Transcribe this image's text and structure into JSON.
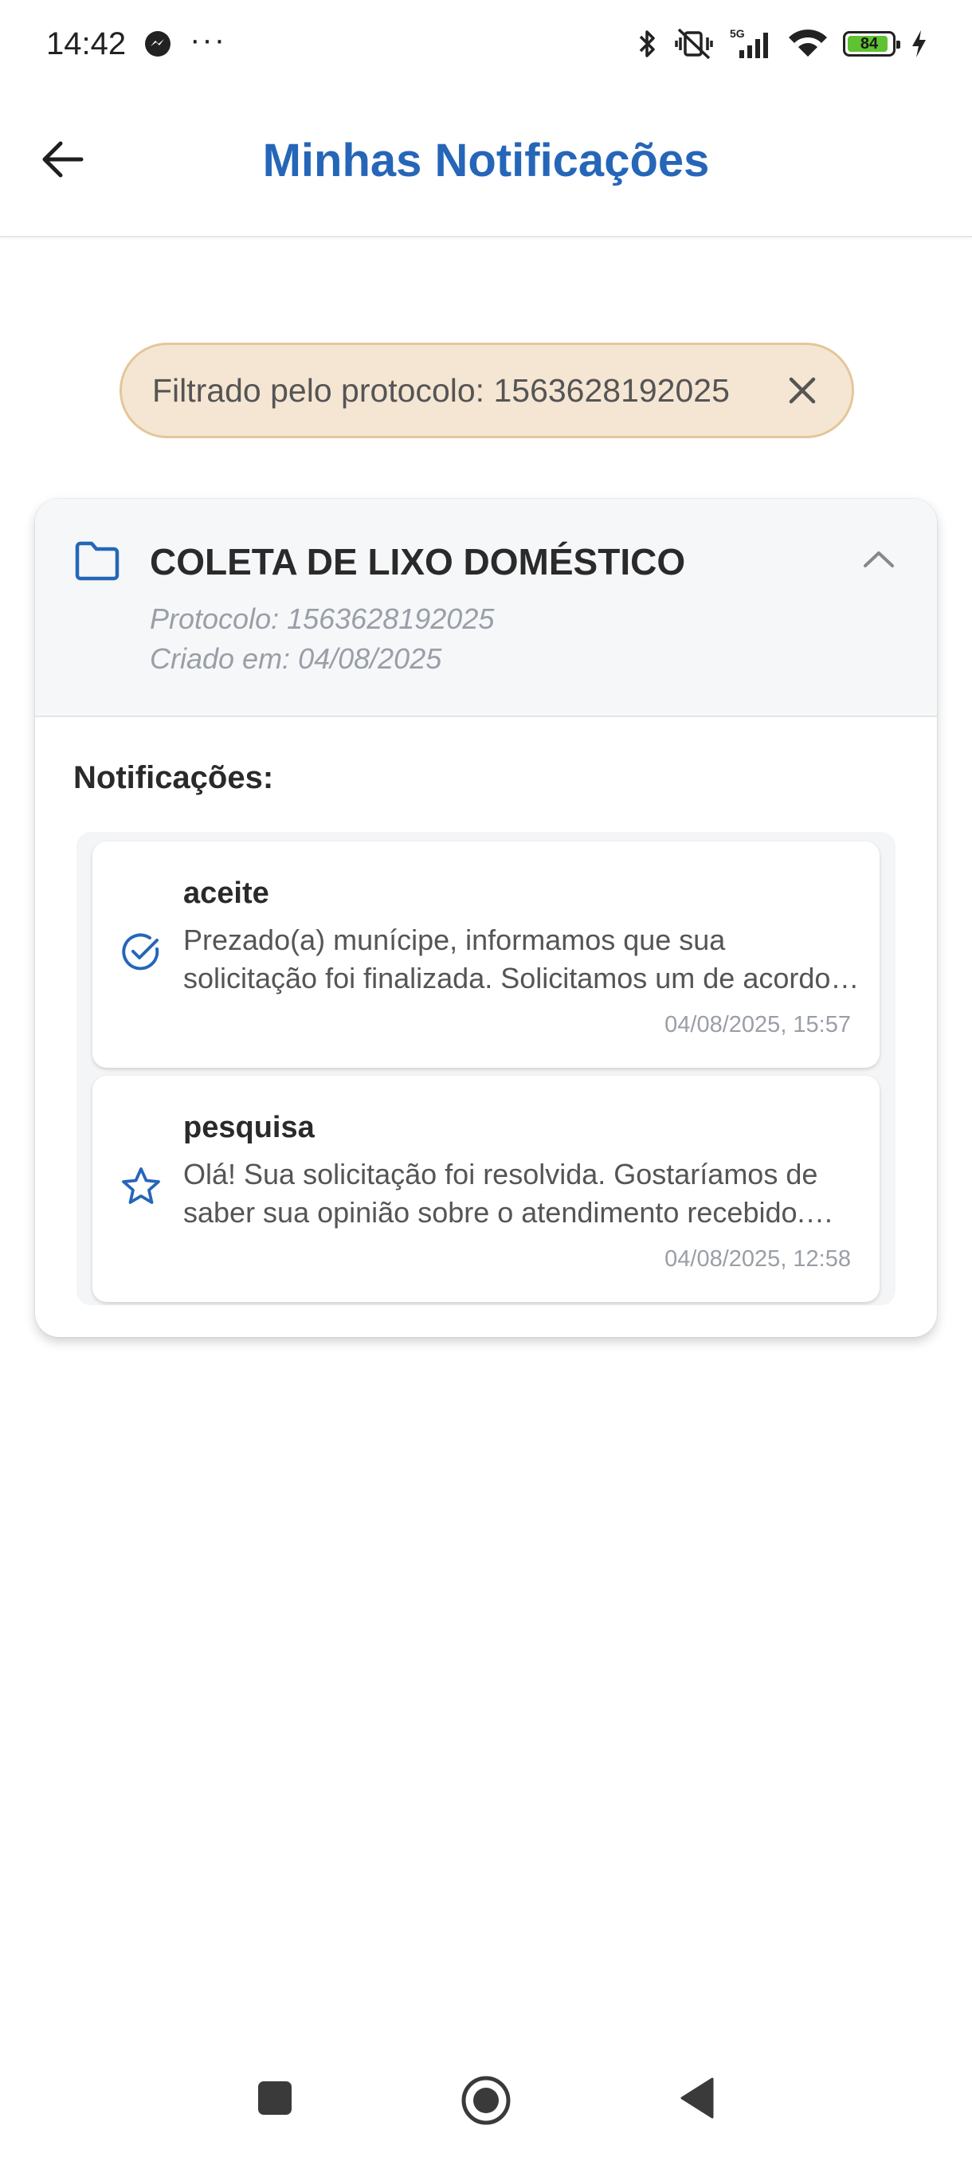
{
  "status_bar": {
    "time": "14:42",
    "dots": "···",
    "battery_level": "84",
    "network_label": "5G"
  },
  "app_bar": {
    "title": "Minhas Notificações"
  },
  "filter": {
    "label": "Filtrado pelo protocolo: 1563628192025"
  },
  "card": {
    "title": "COLETA DE LIXO DOMÉSTICO",
    "protocol": "Protocolo: 1563628192025",
    "created": "Criado em: 04/08/2025",
    "section_label": "Notificações:",
    "notifications": [
      {
        "icon": "check-circle-icon",
        "title": "aceite",
        "body": "Prezado(a) munícipe, informamos que sua solicitação foi finalizada.  Solicitamos um de acordo para concluir o atendimento.",
        "time": "04/08/2025, 15:57"
      },
      {
        "icon": "star-icon",
        "title": "pesquisa",
        "body": "Olá! Sua solicitação foi resolvida. Gostaríamos de saber sua opinião sobre o atendimento recebido. Responda nossa pesquisa.",
        "time": "04/08/2025, 12:58"
      }
    ]
  },
  "colors": {
    "primary_blue": "#2566b8",
    "chip_bg": "#f5e6d3",
    "chip_border": "#e4c69a",
    "battery_green": "#5ec232",
    "icon_dark": "#222222"
  }
}
